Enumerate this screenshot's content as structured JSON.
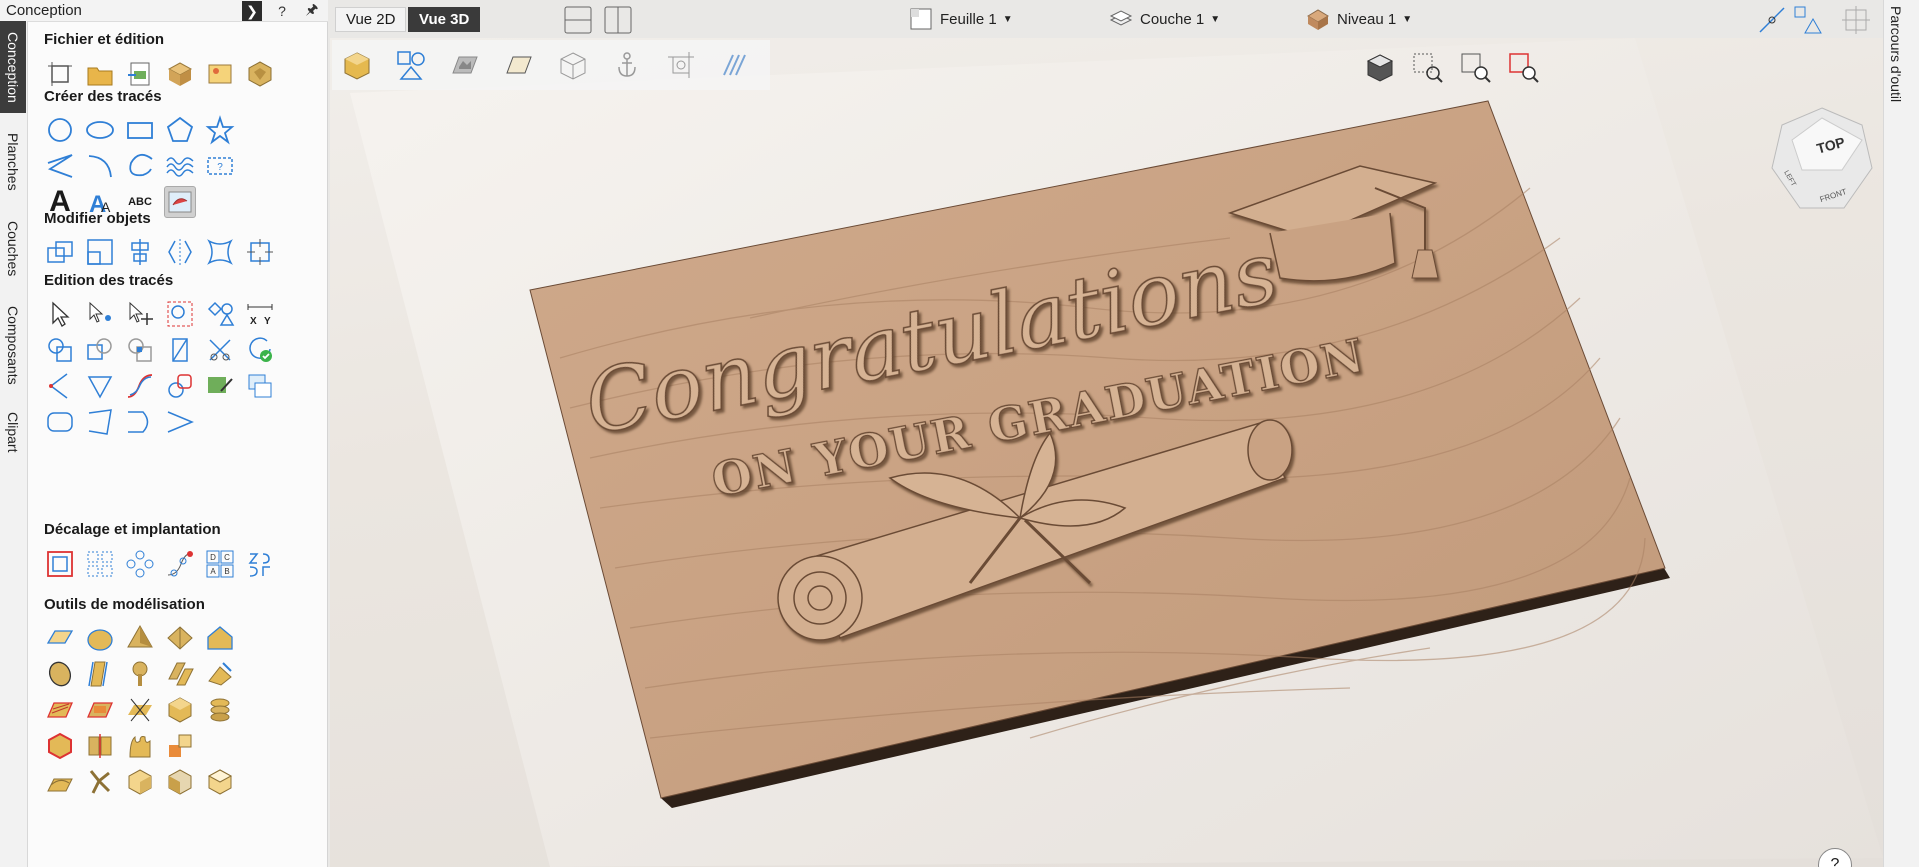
{
  "panel": {
    "title": "Conception",
    "sections": {
      "file": "Fichier et édition",
      "create": "Créer des tracés",
      "modify": "Modifier objets",
      "edit": "Edition des tracés",
      "offset": "Décalage et implantation",
      "modeling": "Outils de modélisation"
    }
  },
  "vtabs": [
    "Conception",
    "Planches",
    "Couches",
    "Composants",
    "Clipart"
  ],
  "rtab": "Parcours d'outil",
  "view": {
    "vue2d": "Vue 2D",
    "vue3d": "Vue 3D",
    "sheet": "Feuille 1",
    "layer": "Couche 1",
    "level": "Niveau 1"
  },
  "model": {
    "line1": "Congratulations",
    "line2": "ON YOUR GRADUATION"
  },
  "viewcube": {
    "top": "TOP",
    "left": "LEFT",
    "front": "FRONT"
  },
  "text_tool_glyphs": {
    "big_a": "A",
    "abc": "ABC"
  },
  "measure_labels": {
    "x": "X",
    "y": "Y"
  },
  "colors": {
    "accent": "#2f7fd6",
    "wood": "#c9a283",
    "active_tab": "#3a3a3a"
  }
}
